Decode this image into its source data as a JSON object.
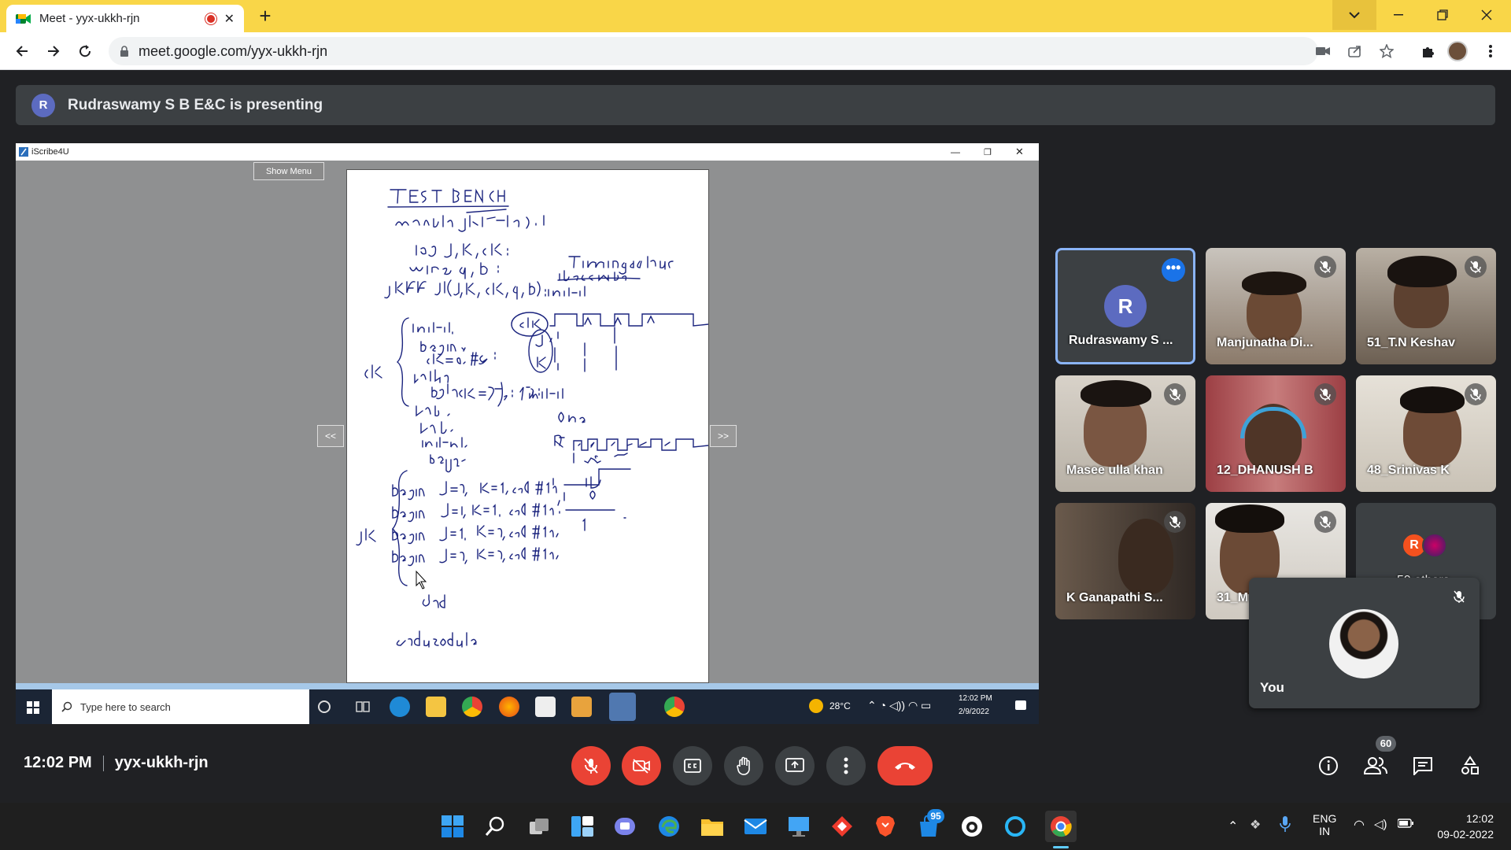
{
  "browser": {
    "tab_title": "Meet - yyx-ukkh-rjn",
    "url": "meet.google.com/yyx-ukkh-rjn"
  },
  "meet": {
    "presenter_initial": "R",
    "presenting_text": "Rudraswamy S B E&C is presenting",
    "time": "12:02 PM",
    "meeting_code": "yyx-ukkh-rjn",
    "people_count": "60",
    "others_text": "59 others"
  },
  "shared_screen": {
    "app_title": "iScribe4U",
    "show_menu": "Show Menu",
    "prev_label": "<<",
    "next_label": ">>",
    "taskbar_search": "Type here to search",
    "weather": "28°C",
    "clock_time": "12:02 PM",
    "clock_date": "2/9/2022"
  },
  "participants": [
    {
      "name": "Rudraswamy S ...",
      "initial": "R"
    },
    {
      "name": "Manjunatha Di..."
    },
    {
      "name": "51_T.N Keshav"
    },
    {
      "name": "Masee ulla khan"
    },
    {
      "name": "12_DHANUSH B"
    },
    {
      "name": "48_Srinivas K"
    },
    {
      "name": "K Ganapathi S..."
    },
    {
      "name": "31_M"
    }
  ],
  "self": {
    "label": "You"
  },
  "os_taskbar": {
    "lang1": "ENG",
    "lang2": "IN",
    "time": "12:02",
    "date": "09-02-2022",
    "notif_badge": "95"
  },
  "colors": {
    "tab_strip": "#f9d648",
    "meet_bg": "#202124",
    "end_call": "#ea4335",
    "active_speaker": "#8ab4f8"
  }
}
